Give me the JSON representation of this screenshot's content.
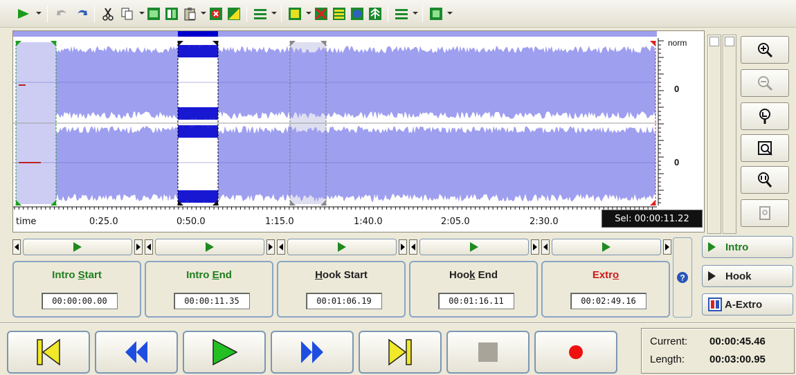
{
  "waveform": {
    "norm_label": "norm",
    "db_top": "0",
    "db_bottom": "0",
    "time_labels": [
      "time",
      "0:25.0",
      "0:50.0",
      "1:15.0",
      "1:40.0",
      "2:05.0",
      "2:30.0"
    ],
    "selection": "Sel: 00:00:11.22"
  },
  "markers": [
    {
      "title_pre": "Intro ",
      "title_u": "S",
      "title_post": "tart",
      "time": "00:00:00.00",
      "color": "green"
    },
    {
      "title_pre": "Intro ",
      "title_u": "E",
      "title_post": "nd",
      "time": "00:00:11.35",
      "color": "green"
    },
    {
      "title_pre": "",
      "title_u": "H",
      "title_post": "ook Start",
      "time": "00:01:06.19",
      "color": "dark"
    },
    {
      "title_pre": "Hoo",
      "title_u": "k",
      "title_post": " End",
      "time": "00:01:16.11",
      "color": "dark"
    },
    {
      "title_pre": "Extr",
      "title_u": "o",
      "title_post": "",
      "time": "00:02:49.16",
      "color": "red"
    }
  ],
  "jump_buttons": {
    "intro": "Intro",
    "hook": "Hook",
    "a_extro": "A-Extro"
  },
  "status": {
    "current_label": "Current:",
    "current_value": "00:00:45.46",
    "length_label": "Length:",
    "length_value": "00:03:00.95"
  },
  "colors": {
    "wave": "#9f9ff0",
    "selection": "#0000cc",
    "intro_region": "#b8b8f0"
  }
}
